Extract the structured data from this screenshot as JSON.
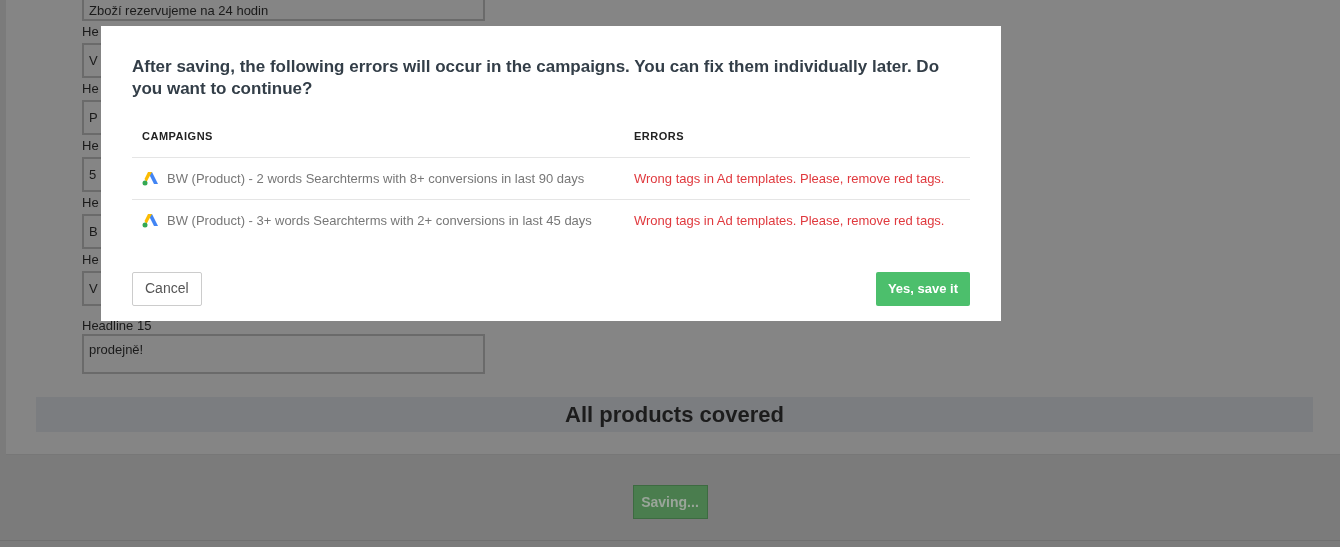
{
  "background_form": {
    "fields": [
      {
        "value": "Zboží rezervujeme na 24 hodin"
      },
      {
        "label": "He",
        "value": "V"
      },
      {
        "label": "He",
        "value": "P"
      },
      {
        "label": "He",
        "value": "5"
      },
      {
        "label": "He",
        "value": "B"
      },
      {
        "label": "He",
        "value": "V"
      },
      {
        "label": "Headline 15",
        "value": "prodejně!"
      }
    ],
    "coverage_banner": "All products covered",
    "save_button": {
      "label": "Saving...",
      "disabled": true
    }
  },
  "dialog": {
    "message": "After saving, the following errors will occur in the campaigns. You can fix them individually later. Do you want to continue?",
    "columns": [
      "CAMPAIGNS",
      "ERRORS"
    ],
    "rows": [
      {
        "campaign": "BW (Product) - 2 words Searchterms with 8+ conversions in last 90 days",
        "error": "Wrong tags in Ad templates. Please, remove red tags."
      },
      {
        "campaign": "BW (Product) - 3+ words Searchterms with 2+ conversions in last 45 days",
        "error": "Wrong tags in Ad templates. Please, remove red tags."
      }
    ],
    "cancel_button": "Cancel",
    "confirm_button": "Yes, save it"
  }
}
